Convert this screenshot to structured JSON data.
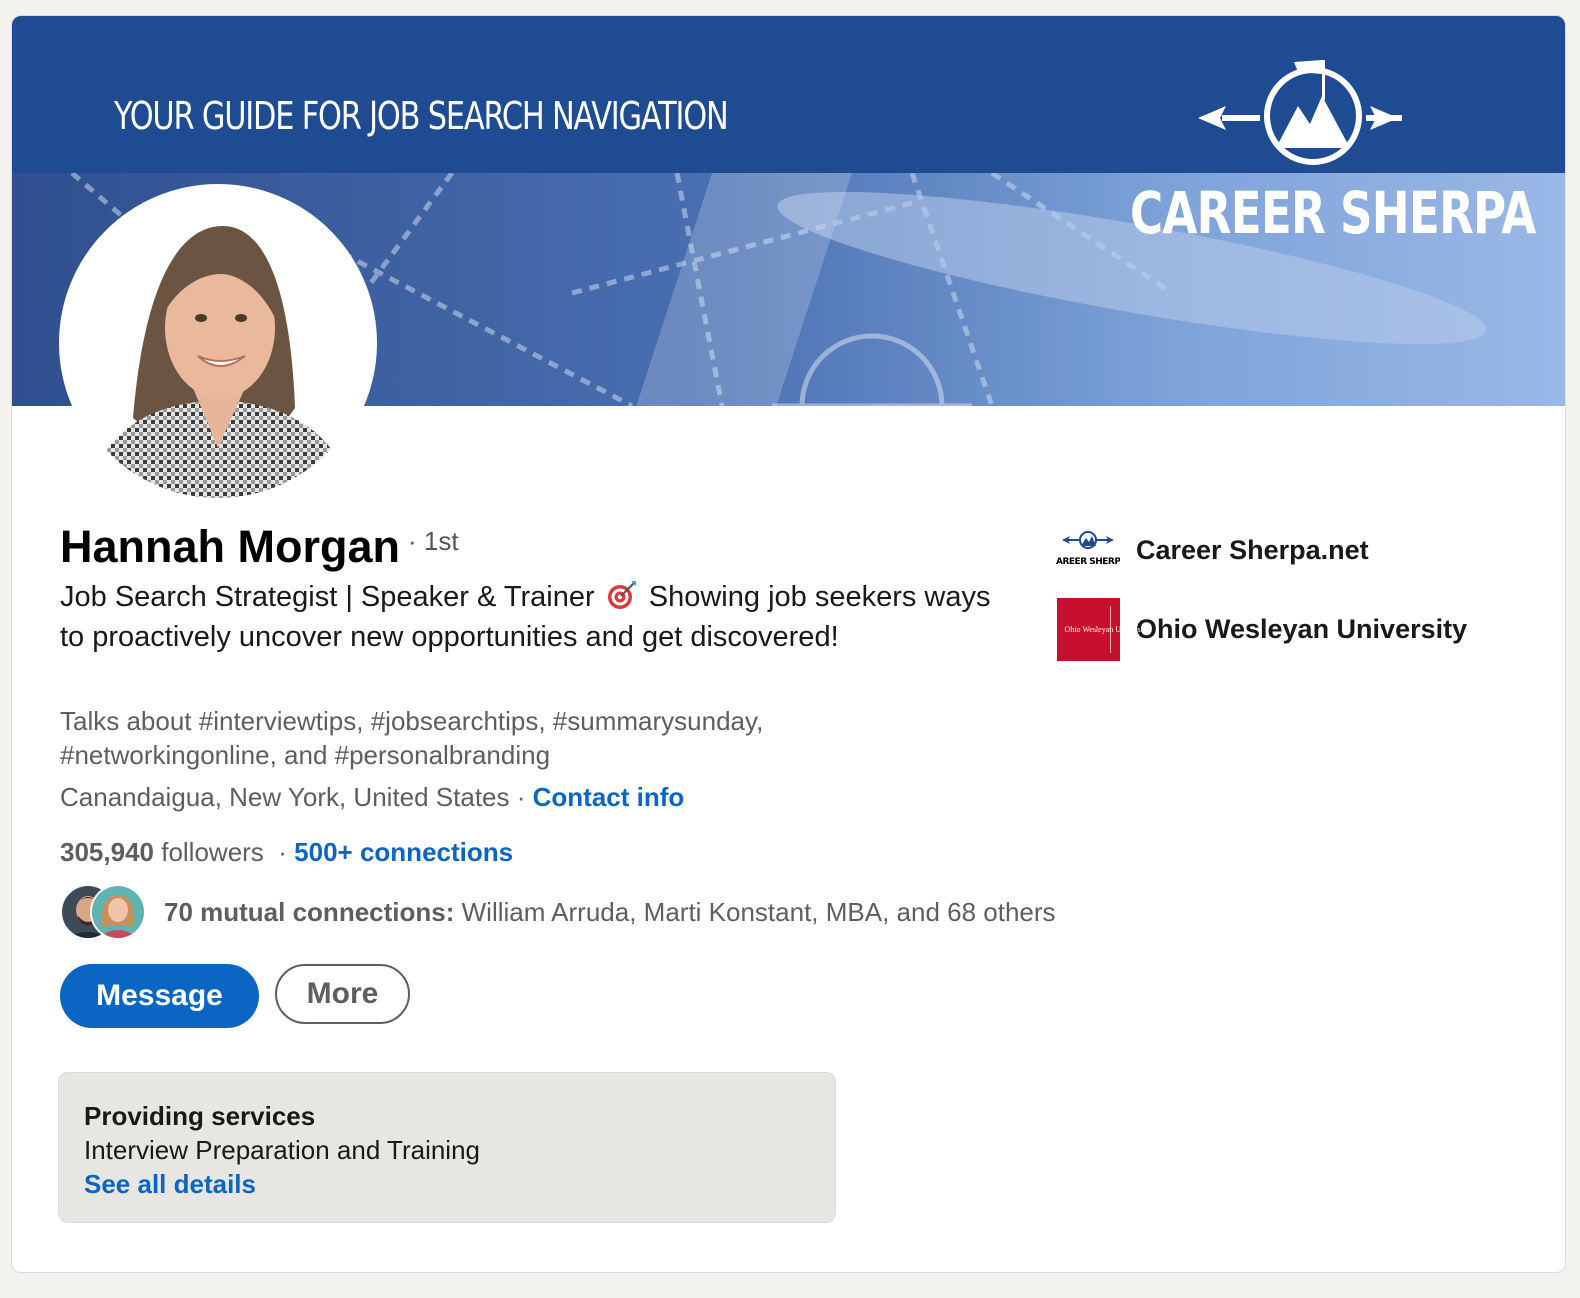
{
  "banner": {
    "tagline": "YOUR GUIDE FOR JOB SEARCH NAVIGATION",
    "logo_text": "CAREER SHERPA"
  },
  "profile": {
    "name": "Hannah Morgan",
    "degree": "· 1st",
    "headline_part1": "Job Search Strategist | Speaker & Trainer",
    "headline_part2": "Showing job seekers ways to proactively uncover new opportunities and get discovered!",
    "talks_about": "Talks about #interviewtips, #jobsearchtips, #summarysunday, #networkingonline, and #personalbranding",
    "location": "Canandaigua, New York, United States",
    "location_separator": " · ",
    "contact_info_label": "Contact info"
  },
  "stats": {
    "followers_count": "305,940",
    "followers_label": "followers",
    "separator": "·",
    "connections_label": "500+ connections"
  },
  "mutual": {
    "label": "70 mutual connections:",
    "names": "William Arruda, Marti Konstant, MBA, and 68 others"
  },
  "actions": {
    "message_label": "Message",
    "more_label": "More"
  },
  "services": {
    "title": "Providing services",
    "text": "Interview Preparation and Training",
    "link_label": "See all details"
  },
  "organizations": [
    {
      "name": "Career Sherpa.net",
      "logo_text": "CAREER SHERPA",
      "icon": "career-sherpa-logo"
    },
    {
      "name": "Ohio Wesleyan University",
      "logo_text": "Ohio Wesleyan University",
      "icon": "ohio-wesleyan-logo"
    }
  ],
  "colors": {
    "banner_blue": "#1e4b91",
    "link_blue": "#0a66c2",
    "owu_red": "#c8102e"
  }
}
